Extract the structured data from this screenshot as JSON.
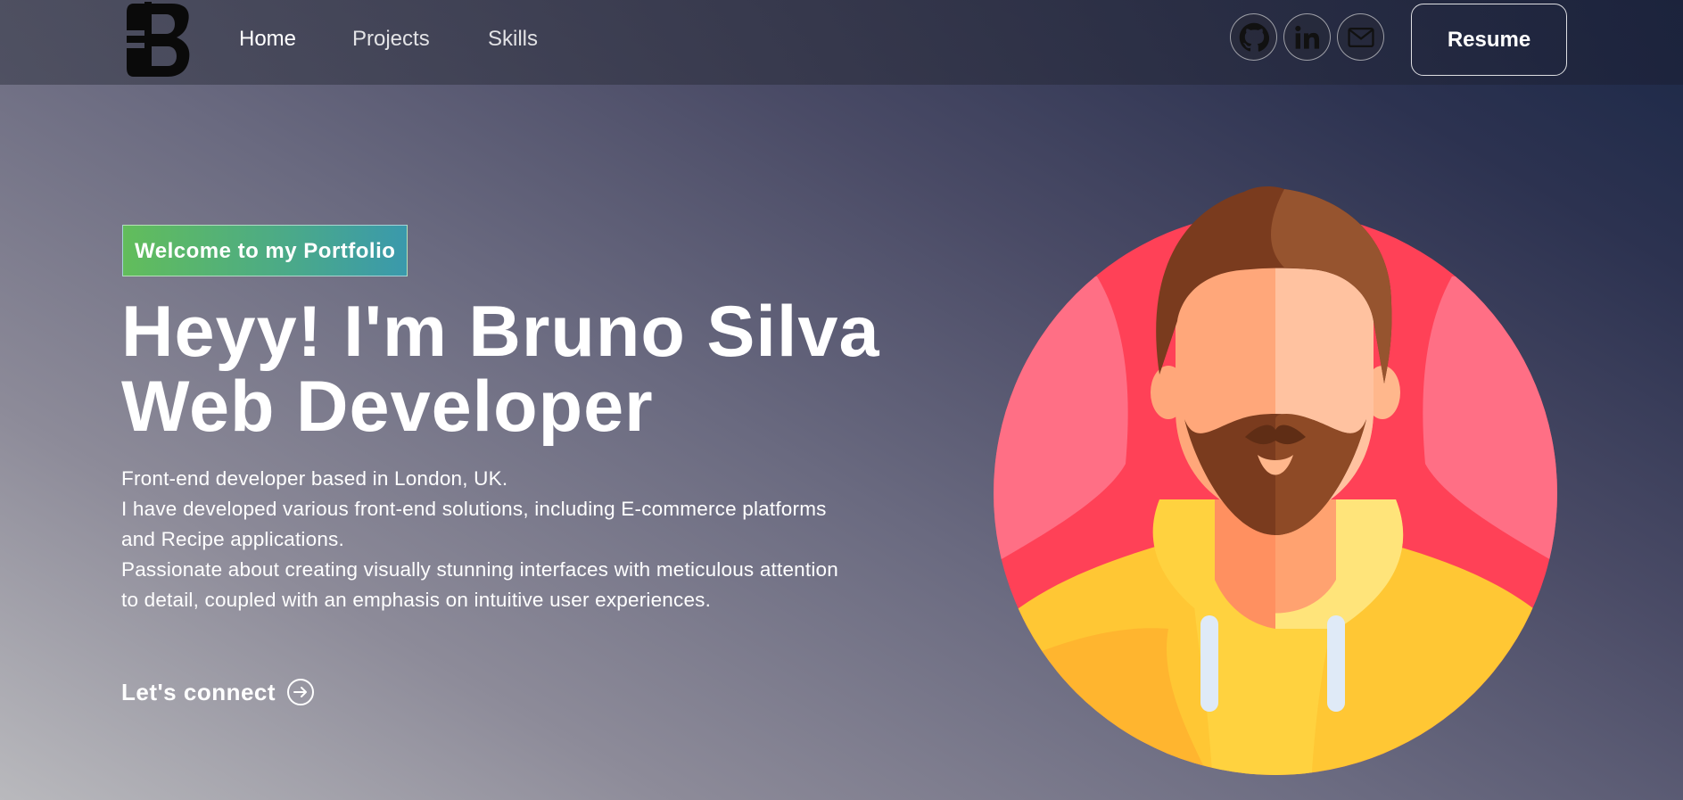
{
  "nav": {
    "logo_icon": "bs-monogram-logo",
    "links": [
      "Home",
      "Projects",
      "Skills"
    ],
    "social_icons": [
      "github-icon",
      "linkedin-icon",
      "mail-icon"
    ],
    "resume_label": "Resume"
  },
  "hero": {
    "tagline": "Welcome to my Portfolio",
    "headline_line1": "Heyy! I'm Bruno Silva",
    "headline_line2": "Web Developer",
    "intro_p1": "Front-end developer based in London, UK.",
    "intro_p2": "I have developed various front-end solutions, including E-commerce platforms\nand Recipe applications.",
    "intro_p3": "Passionate about creating visually stunning interfaces with meticulous attention\nto detail, coupled with an emphasis on intuitive user experiences.",
    "cta_label": "Let's connect",
    "cta_icon": "arrow-right-circle-icon",
    "illustration": "bearded-man-avatar"
  },
  "colors": {
    "tagline_gradient_start": "#62bd5b",
    "tagline_gradient_end": "#3a99ac",
    "avatar_bg": "#ff4157",
    "avatar_bg_light": "#ff6f85",
    "hoodie": "#ffc734"
  }
}
